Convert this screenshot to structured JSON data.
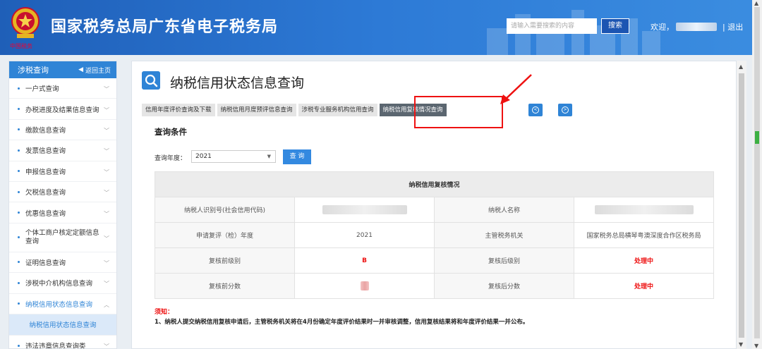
{
  "header": {
    "site_title": "国家税务总局广东省电子税务局",
    "logo_text": "中国税务",
    "search_placeholder": "请输入需要搜索的内容",
    "search_button": "搜索",
    "welcome": "欢迎，",
    "logout": "| 退出"
  },
  "sidebar": {
    "title": "涉税查询",
    "back_label": "返回主页",
    "items": [
      {
        "label": "一户式查询"
      },
      {
        "label": "办税进度及结果信息查询"
      },
      {
        "label": "缴款信息查询"
      },
      {
        "label": "发票信息查询"
      },
      {
        "label": "申报信息查询"
      },
      {
        "label": "欠税信息查询"
      },
      {
        "label": "优惠信息查询"
      },
      {
        "label": "个体工商户核定定额信息查询"
      },
      {
        "label": "证明信息查询"
      },
      {
        "label": "涉税中介机构信息查询"
      },
      {
        "label": "纳税信用状态信息查询"
      },
      {
        "label": "违法违章信息查询类"
      }
    ],
    "sub_item": "纳税信用状态信息查询"
  },
  "page": {
    "title": "纳税信用状态信息查询",
    "tabs": [
      "信用年度评价查询及下载",
      "纳税信用月度预评信息查询",
      "涉税专业服务机构信用查询",
      "纳税信用复核情况查询"
    ],
    "section_title": "查询条件",
    "year_label": "查询年度：",
    "year_value": "2021",
    "query_button": "查 询"
  },
  "table": {
    "header": "纳税信用复核情况",
    "rows": [
      {
        "l1": "纳税人识别号(社会信用代码)",
        "v1": "",
        "l2": "纳税人名称",
        "v2": ""
      },
      {
        "l1": "申请复评（检）年度",
        "v1": "2021",
        "l2": "主管税务机关",
        "v2": "国家税务总局横琴粤澳深度合作区税务局"
      },
      {
        "l1": "复核前级别",
        "v1": "B",
        "l2": "复核后级别",
        "v2": "处理中"
      },
      {
        "l1": "复核前分数",
        "v1": "",
        "l2": "复核后分数",
        "v2": "处理中"
      }
    ]
  },
  "notice": {
    "title": "须知：",
    "text": "1、纳税人提交纳税信用复核申请后，主管税务机关将在4月份确定年度评价结果时一并审核调整，信用复核结果将和年度评价结果一并公布。"
  },
  "colors": {
    "header_blue": "#2d7ad6",
    "accent": "#2f84d6",
    "alert_red": "#e11111"
  }
}
